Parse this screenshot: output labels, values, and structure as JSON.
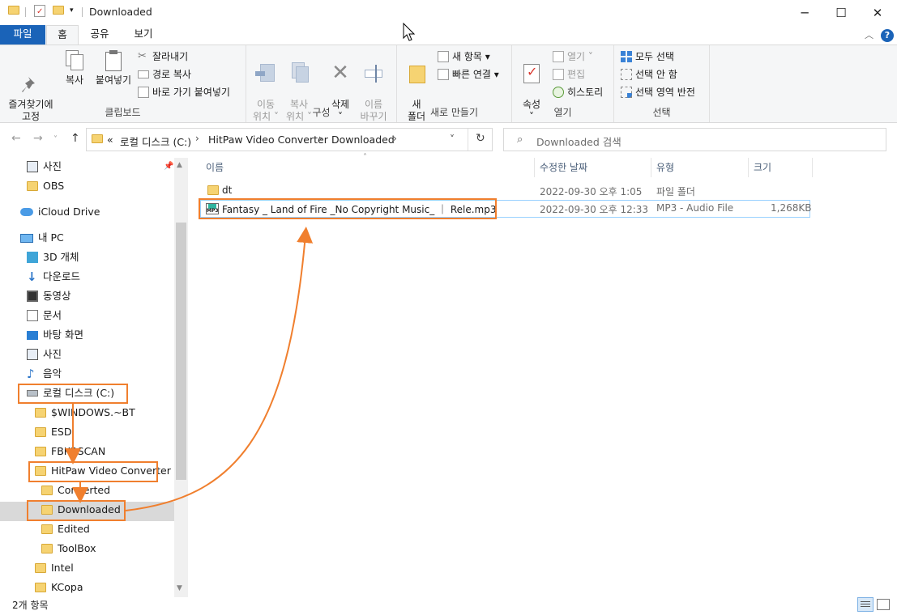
{
  "window": {
    "title": "Downloaded",
    "minimize": "─",
    "maximize": "☐",
    "close": "✕"
  },
  "ribbon_tabs": [
    "파일",
    "홈",
    "공유",
    "보기"
  ],
  "ribbon": {
    "clipboard": {
      "label": "클립보드",
      "pin": "즐겨찾기에\n고정",
      "copy": "복사",
      "paste": "붙여넣기",
      "cut": "잘라내기",
      "copy_path": "경로 복사",
      "paste_shortcut": "바로 가기 붙여넣기"
    },
    "organize": {
      "label": "구성",
      "move_to": "이동\n위치 ˅",
      "copy_to": "복사\n위치 ˅",
      "delete": "삭제\n˅",
      "rename": "이름\n바꾸기"
    },
    "new": {
      "label": "새로 만들기",
      "new_folder": "새\n폴더",
      "new_item": "새 항목 ▾",
      "easy_access": "빠른 연결 ▾"
    },
    "open": {
      "label": "열기",
      "properties": "속성\n˅",
      "open": "열기 ˅",
      "edit": "편집",
      "history": "히스토리"
    },
    "select": {
      "label": "선택",
      "select_all": "모두 선택",
      "select_none": "선택 안 함",
      "invert": "선택 영역 반전"
    }
  },
  "address": {
    "back": "←",
    "forward": "→",
    "up": "↑",
    "prefix": "«",
    "crumbs": [
      "로컬 디스크 (C:)",
      "HitPaw Video Converter",
      "Downloaded"
    ],
    "search_placeholder": "Downloaded 검색"
  },
  "nav": [
    {
      "label": "사진",
      "icon": "pictures-icon"
    },
    {
      "label": "OBS",
      "icon": "folder-icon"
    },
    {
      "label": "iCloud Drive",
      "icon": "icloud-icon"
    },
    {
      "label": "내 PC",
      "icon": "pc-icon"
    },
    {
      "label": "3D 개체",
      "icon": "3d-objects-icon"
    },
    {
      "label": "다운로드",
      "icon": "download-icon"
    },
    {
      "label": "동영상",
      "icon": "video-icon"
    },
    {
      "label": "문서",
      "icon": "document-icon"
    },
    {
      "label": "바탕 화면",
      "icon": "desktop-icon"
    },
    {
      "label": "사진",
      "icon": "pictures-icon"
    },
    {
      "label": "음악",
      "icon": "music-icon"
    },
    {
      "label": "로컬 디스크 (C:)",
      "icon": "drive-icon"
    },
    {
      "label": "$WINDOWS.~BT",
      "icon": "folder-icon"
    },
    {
      "label": "ESD",
      "icon": "folder-icon"
    },
    {
      "label": "FBKRSCAN",
      "icon": "folder-icon"
    },
    {
      "label": "HitPaw Video Converter",
      "icon": "folder-icon"
    },
    {
      "label": "Converted",
      "icon": "folder-icon"
    },
    {
      "label": "Downloaded",
      "icon": "folder-icon"
    },
    {
      "label": "Edited",
      "icon": "folder-icon"
    },
    {
      "label": "ToolBox",
      "icon": "folder-icon"
    },
    {
      "label": "Intel",
      "icon": "folder-icon"
    },
    {
      "label": "KCopa",
      "icon": "folder-icon"
    }
  ],
  "columns": {
    "name": "이름",
    "modified": "수정한 날짜",
    "type": "유형",
    "size": "크기"
  },
  "files": [
    {
      "name": "dt",
      "modified": "2022-09-30 오후 1:05",
      "type": "파일 폴더",
      "size": ""
    },
    {
      "name": "Fantasy _ Land of Fire _No Copyright Music_ ｜ Rele.mp3",
      "modified": "2022-09-30 오후 12:33",
      "type": "MP3 - Audio File",
      "size": "1,268KB"
    }
  ],
  "status": {
    "count": "2개 항목"
  },
  "colors": {
    "accent": "#1a63b8",
    "highlight": "#f07f2e",
    "folder": "#f6d372"
  }
}
